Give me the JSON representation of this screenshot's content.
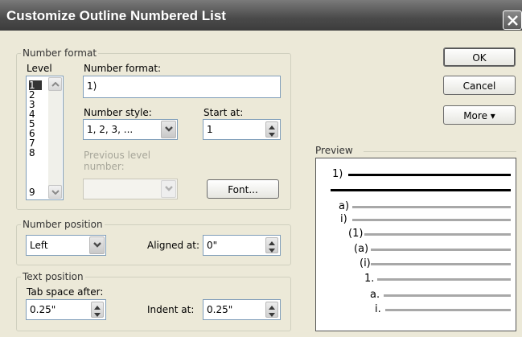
{
  "window": {
    "title": "Customize Outline Numbered List"
  },
  "number_format_group": {
    "legend": "Number format",
    "level_label": "Level",
    "levels": [
      "1",
      "2",
      "3",
      "4",
      "5",
      "6",
      "7",
      "8",
      "9"
    ],
    "selected_level": "1",
    "number_format_label": "Number format:",
    "number_format_value": "1)",
    "number_style_label": "Number style:",
    "number_style_value": "1, 2, 3, ...",
    "start_at_label": "Start at:",
    "start_at_value": "1",
    "previous_level_label": "Previous level number:",
    "font_button": "Font..."
  },
  "number_position_group": {
    "legend": "Number position",
    "alignment_value": "Left",
    "aligned_at_label": "Aligned at:",
    "aligned_at_value": "0\""
  },
  "text_position_group": {
    "legend": "Text position",
    "tab_space_label": "Tab space after:",
    "tab_space_value": "0.25\"",
    "indent_at_label": "Indent at:",
    "indent_at_value": "0.25\""
  },
  "buttons": {
    "ok": "OK",
    "cancel": "Cancel",
    "more": "More ▾"
  },
  "preview": {
    "legend": "Preview",
    "items": [
      {
        "label": "1)",
        "emphasis": "bold"
      },
      {
        "label": "",
        "emphasis": "bold"
      },
      {
        "label": "a)",
        "emphasis": "light"
      },
      {
        "label": "i)",
        "emphasis": "light"
      },
      {
        "label": "(1)",
        "emphasis": "light"
      },
      {
        "label": "(a)",
        "emphasis": "light"
      },
      {
        "label": "(i)",
        "emphasis": "light"
      },
      {
        "label": "1.",
        "emphasis": "light"
      },
      {
        "label": "a.",
        "emphasis": "light"
      },
      {
        "label": "i.",
        "emphasis": "light"
      }
    ]
  },
  "colors": {
    "dialog_bg": "#ece9d8",
    "titlebar": "#4a4a4a",
    "field_border": "#7f9db9",
    "preview_bold_line": "#000000",
    "preview_light_line": "#a8a8a8"
  }
}
